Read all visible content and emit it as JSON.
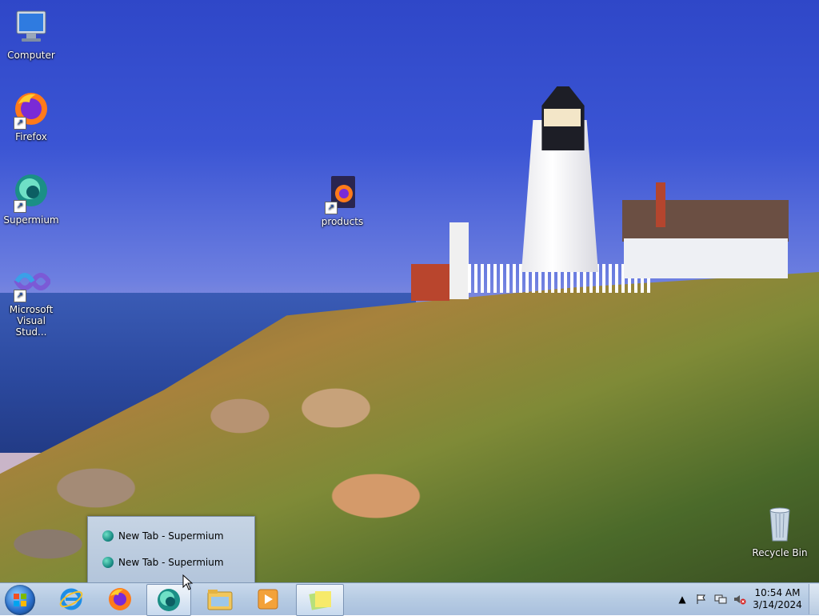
{
  "desktop": {
    "icons": [
      {
        "label": "Computer"
      },
      {
        "label": "Firefox"
      },
      {
        "label": "Supermium"
      },
      {
        "label": "Microsoft Visual Stud..."
      },
      {
        "label": "products"
      },
      {
        "label": "Recycle Bin"
      }
    ]
  },
  "thumbnail_popup": {
    "items": [
      {
        "label": "New Tab - Supermium"
      },
      {
        "label": "New Tab - Supermium"
      }
    ]
  },
  "taskbar": {
    "buttons": [
      {
        "icon": "internet-explorer-icon"
      },
      {
        "icon": "firefox-icon"
      },
      {
        "icon": "supermium-icon",
        "active": true
      },
      {
        "icon": "file-explorer-icon"
      },
      {
        "icon": "media-player-icon"
      },
      {
        "icon": "sticky-notes-icon",
        "active": true
      }
    ],
    "tray": {
      "time": "10:54 AM",
      "date": "3/14/2024"
    }
  },
  "colors": {
    "taskbar_top": "#c9d9ec",
    "taskbar_bottom": "#a9c0dd",
    "sky": "#3b55d4"
  }
}
